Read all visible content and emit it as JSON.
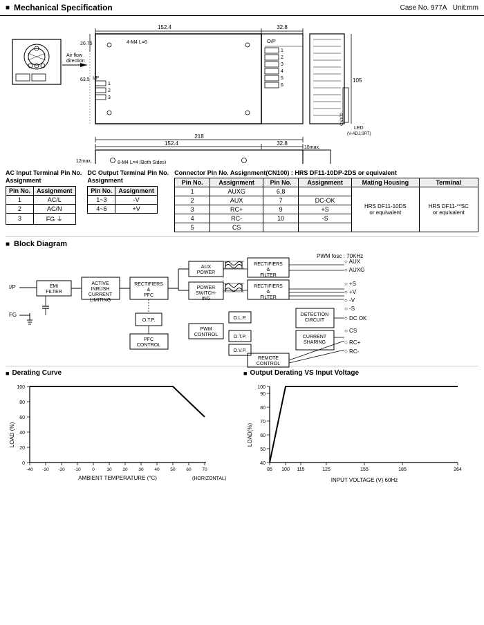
{
  "header": {
    "title": "Mechanical Specification",
    "case_no": "Case No. 977A",
    "unit": "Unit:mm"
  },
  "ac_table": {
    "title": "AC Input Terminal Pin No. Assignment",
    "headers": [
      "Pin No.",
      "Assignment"
    ],
    "rows": [
      [
        "1",
        "AC/L"
      ],
      [
        "2",
        "AC/N"
      ],
      [
        "3",
        "FG ⏚"
      ]
    ]
  },
  "dc_table": {
    "title": "DC Output Terminal Pin No. Assignment",
    "headers": [
      "Pin No.",
      "Assignment"
    ],
    "rows": [
      [
        "1~3",
        "-V"
      ],
      [
        "4~6",
        "+V"
      ]
    ]
  },
  "cn100": {
    "title": "Connector Pin No. Assignment(CN100) : HRS DF11-10DP-2DS or equivalent",
    "headers": [
      "Pin No.",
      "Assignment",
      "Pin No.",
      "Assignment",
      "Mating Housing",
      "Terminal"
    ],
    "rows": [
      [
        "1",
        "AUXG",
        "6,8",
        "",
        "HRS DF11-10DS or equivalent",
        "HRS DF11-**SC or equivalent"
      ],
      [
        "2",
        "AUX",
        "7",
        "DC-OK",
        "",
        ""
      ],
      [
        "3",
        "RC+",
        "9",
        "+S",
        "",
        ""
      ],
      [
        "4",
        "RC-",
        "10",
        "-S",
        "",
        ""
      ],
      [
        "5",
        "CS",
        "",
        "",
        "",
        ""
      ]
    ]
  },
  "block_diagram": {
    "title": "Block Diagram",
    "pwm": "PWM fosc : 70KHz",
    "blocks": [
      "EMI FILTER",
      "ACTIVE INRUSH CURRENT LIMITING",
      "RECTIFIERS & PFC",
      "RECTIFIERS & PFC",
      "AUX POWER",
      "POWER SWITCHING",
      "RECTIFIERS & FILTER",
      "RECTIFIERS & FILTER",
      "O.T.P.",
      "O.L.P.",
      "O.T.P.",
      "O.V.P.",
      "DETECTION CIRCUIT",
      "CURRENT SHARING",
      "PFC CONTROL",
      "PWM CONTROL",
      "REMOTE CONTROL"
    ],
    "outputs": [
      "AUX",
      "AUXG",
      "+S",
      "+V",
      "-V",
      "-S",
      "DC OK",
      "CS",
      "RC+",
      "RC-"
    ],
    "inputs": [
      "I/P",
      "FG"
    ]
  },
  "derating_curve": {
    "title": "Derating Curve",
    "x_label": "AMBIENT TEMPERATURE (°C)",
    "y_label": "LOAD (%)",
    "x_note": "(HORIZONTAL)",
    "x_ticks": [
      "-40",
      "-30",
      "-20",
      "-10",
      "0",
      "10",
      "20",
      "30",
      "40",
      "50",
      "60",
      "70"
    ],
    "y_ticks": [
      "20",
      "40",
      "60",
      "80",
      "100"
    ],
    "line_points": "flat_then_drop",
    "flat_end_x": 50,
    "drop_end_x": 70,
    "drop_end_y": 60
  },
  "output_derating": {
    "title": "Output Derating VS Input Voltage",
    "x_label": "INPUT VOLTAGE (V) 60Hz",
    "y_label": "LOAD(%)",
    "x_ticks": [
      "85",
      "100",
      "115",
      "125",
      "155",
      "185",
      "264"
    ],
    "y_ticks": [
      "40",
      "50",
      "60",
      "70",
      "80",
      "90",
      "100"
    ],
    "line_note": "ramp_then_flat"
  }
}
